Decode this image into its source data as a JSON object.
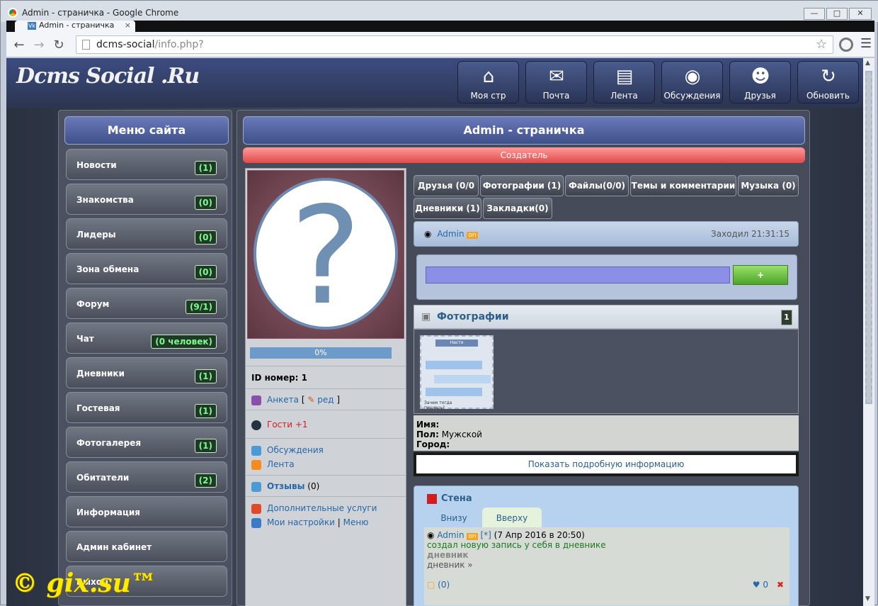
{
  "window": {
    "title": "Admin - страничка - Google Chrome"
  },
  "tab": {
    "title": "Admin - страничка",
    "favicon": "Vk"
  },
  "address": {
    "host": "dcms-social",
    "path": "/info.php?"
  },
  "header": {
    "logo": "Dcms Social .Ru",
    "buttons": [
      {
        "label": "Моя стр",
        "icon": "home-icon"
      },
      {
        "label": "Почта",
        "icon": "mail-icon"
      },
      {
        "label": "Лента",
        "icon": "document-icon"
      },
      {
        "label": "Обсуждения",
        "icon": "chat-icon"
      },
      {
        "label": "Друзья",
        "icon": "users-icon"
      },
      {
        "label": "Обновить",
        "icon": "refresh-icon"
      }
    ]
  },
  "sidebar": {
    "title": "Меню сайта",
    "items": [
      {
        "label": "Новости",
        "count": "(1)"
      },
      {
        "label": "Знакомства",
        "count": "(0)"
      },
      {
        "label": "Лидеры",
        "count": "(0)"
      },
      {
        "label": "Зона обмена",
        "count": "(0)"
      },
      {
        "label": "Форум",
        "count": "(9/1)"
      },
      {
        "label": "Чат",
        "count": "(0 человек)"
      },
      {
        "label": "Дневники",
        "count": "(1)"
      },
      {
        "label": "Гостевая",
        "count": "(1)"
      },
      {
        "label": "Фотогалерея",
        "count": "(1)"
      },
      {
        "label": "Обитатели",
        "count": "(2)"
      },
      {
        "label": "Информация",
        "count": ""
      },
      {
        "label": "Админ кабинет",
        "count": ""
      },
      {
        "label": "Выход",
        "count": ""
      }
    ]
  },
  "main": {
    "title": "Admin - страничка",
    "role": "Создатель",
    "avatar_glyph": "?",
    "progress": "0%",
    "progress_value": 0,
    "id_line": "ID номер: 1",
    "links": {
      "anketa": "Анкета",
      "bracket_open": "[",
      "red": "ред",
      "bracket_close": "]",
      "guests": "Гости",
      "guests_plus": "+1",
      "discussions": "Обсуждения",
      "feed": "Лента",
      "reviews": "Отзывы",
      "reviews_count": "(0)",
      "extra": "Дополнительные услуги",
      "settings": "Мои настройки",
      "sep": "|",
      "menu": "Меню"
    },
    "tabs": [
      "Друзья (0/0",
      "Фотографии (1)",
      "Файлы(0/0)",
      "Темы и комментарии",
      "Музыка (0)",
      "Дневники (1)",
      "Закладки(0)"
    ],
    "user": {
      "name": "Admin",
      "status": "on",
      "last_seen": "Заходил 21:31:15"
    },
    "post_button": "+",
    "photos": {
      "title": "Фотографии",
      "count": "1"
    },
    "thumb_texts": [
      "Настя",
      "Зачем тогда пишешь?"
    ],
    "info": {
      "name_label": "Имя:",
      "gender_label": "Пол:",
      "gender": "Мужской",
      "city_label": "Город:"
    },
    "more_button": "Показать подробную информацию",
    "wall": {
      "title": "Стена",
      "tab_bottom": "Внизу",
      "tab_top": "Вверху",
      "entry": {
        "author": "Admin",
        "status": "on",
        "link": "[*]",
        "date": "(7 Апр 2016 в 20:50)",
        "text": "создал новую запись у себя в дневнике",
        "category": "дневник",
        "more": "дневник »",
        "comments": "(0)",
        "likes": "♥ 0",
        "delete": "✖"
      }
    }
  },
  "watermark": "© gix.su™"
}
